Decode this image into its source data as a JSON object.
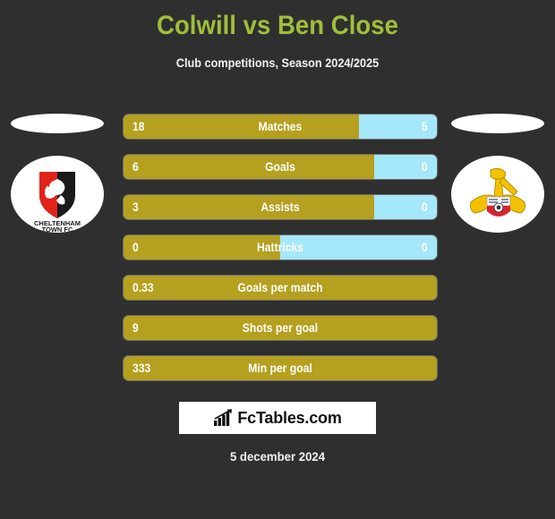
{
  "header": {
    "title": "Colwill vs Ben Close",
    "subtitle": "Club competitions, Season 2024/2025",
    "title_color": "#9fbf3b"
  },
  "teams": {
    "home": {
      "club_name": "CHELTENHAM TOWN FC",
      "crest_name": "cheltenham-town-crest",
      "crest_colors": [
        "#e2231a",
        "#1a1a1a",
        "#ffffff"
      ]
    },
    "away": {
      "club_name": "Doncaster Rovers",
      "crest_name": "doncaster-rovers-crest",
      "crest_colors": [
        "#f2c200",
        "#d9232e",
        "#ffffff"
      ]
    }
  },
  "colors": {
    "background": "#2f2f2f",
    "home_bar": "#b5a01f",
    "away_bar": "#a5e7fb",
    "text": "#ffffff"
  },
  "chart_data": {
    "type": "bar",
    "title": "Colwill vs Ben Close",
    "subtitle": "Club competitions, Season 2024/2025",
    "orientation": "horizontal-diverging",
    "series": [
      {
        "name": "Colwill",
        "values": [
          18,
          6,
          3,
          0,
          0.33,
          9,
          333
        ]
      },
      {
        "name": "Ben Close",
        "values": [
          5,
          0,
          0,
          0,
          null,
          null,
          null
        ]
      }
    ],
    "categories": [
      "Matches",
      "Goals",
      "Assists",
      "Hattricks",
      "Goals per match",
      "Shots per goal",
      "Min per goal"
    ],
    "rows": [
      {
        "label": "Matches",
        "home": "18",
        "away": "5",
        "home_pct": 75,
        "two_sided": true
      },
      {
        "label": "Goals",
        "home": "6",
        "away": "0",
        "home_pct": 80,
        "two_sided": true
      },
      {
        "label": "Assists",
        "home": "3",
        "away": "0",
        "home_pct": 80,
        "two_sided": true
      },
      {
        "label": "Hattricks",
        "home": "0",
        "away": "0",
        "home_pct": 50,
        "two_sided": true
      },
      {
        "label": "Goals per match",
        "home": "0.33",
        "away": "",
        "home_pct": 100,
        "two_sided": false
      },
      {
        "label": "Shots per goal",
        "home": "9",
        "away": "",
        "home_pct": 100,
        "two_sided": false
      },
      {
        "label": "Min per goal",
        "home": "333",
        "away": "",
        "home_pct": 100,
        "two_sided": false
      }
    ]
  },
  "watermark": {
    "text": "FcTables.com",
    "icon": "bar-chart-growth-icon"
  },
  "footer": {
    "date": "5 december 2024"
  }
}
